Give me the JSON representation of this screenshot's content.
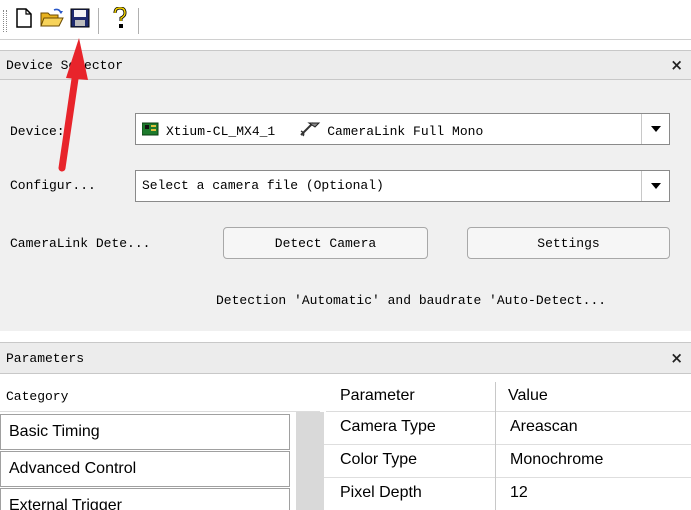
{
  "toolbar": {
    "buttons": [
      {
        "name": "new",
        "icon": "new-file-icon"
      },
      {
        "name": "open",
        "icon": "open-folder-icon"
      },
      {
        "name": "save",
        "icon": "floppy-disk-icon"
      },
      {
        "name": "help",
        "icon": "question-mark-icon"
      }
    ]
  },
  "device_selector": {
    "title": "Device Selector",
    "close_glyph": "×",
    "device_label": "Device:",
    "device_value": "Xtium-CL_MX4_1",
    "device_type": "CameraLink Full Mono",
    "config_label": "Configur...",
    "config_value": "Select a camera file (Optional)",
    "detect_label": "CameraLink Dete...",
    "detect_button": "Detect Camera",
    "settings_button": "Settings",
    "detection_note": "Detection 'Automatic' and baudrate 'Auto-Detect..."
  },
  "parameters": {
    "title": "Parameters",
    "close_glyph": "×",
    "category_header": "Category",
    "categories": [
      "Basic Timing",
      "Advanced Control",
      "External Trigger"
    ],
    "columns": {
      "parameter": "Parameter",
      "value": "Value"
    },
    "rows": [
      {
        "parameter": "Camera Type",
        "value": "Areascan"
      },
      {
        "parameter": "Color Type",
        "value": "Monochrome"
      },
      {
        "parameter": "Pixel Depth",
        "value": "12"
      }
    ]
  },
  "colors": {
    "annotation_arrow": "#e8242b",
    "panel_header": "#ececec",
    "panel_body": "#f0f0f0",
    "grid_gutter": "#d9d9d9"
  }
}
